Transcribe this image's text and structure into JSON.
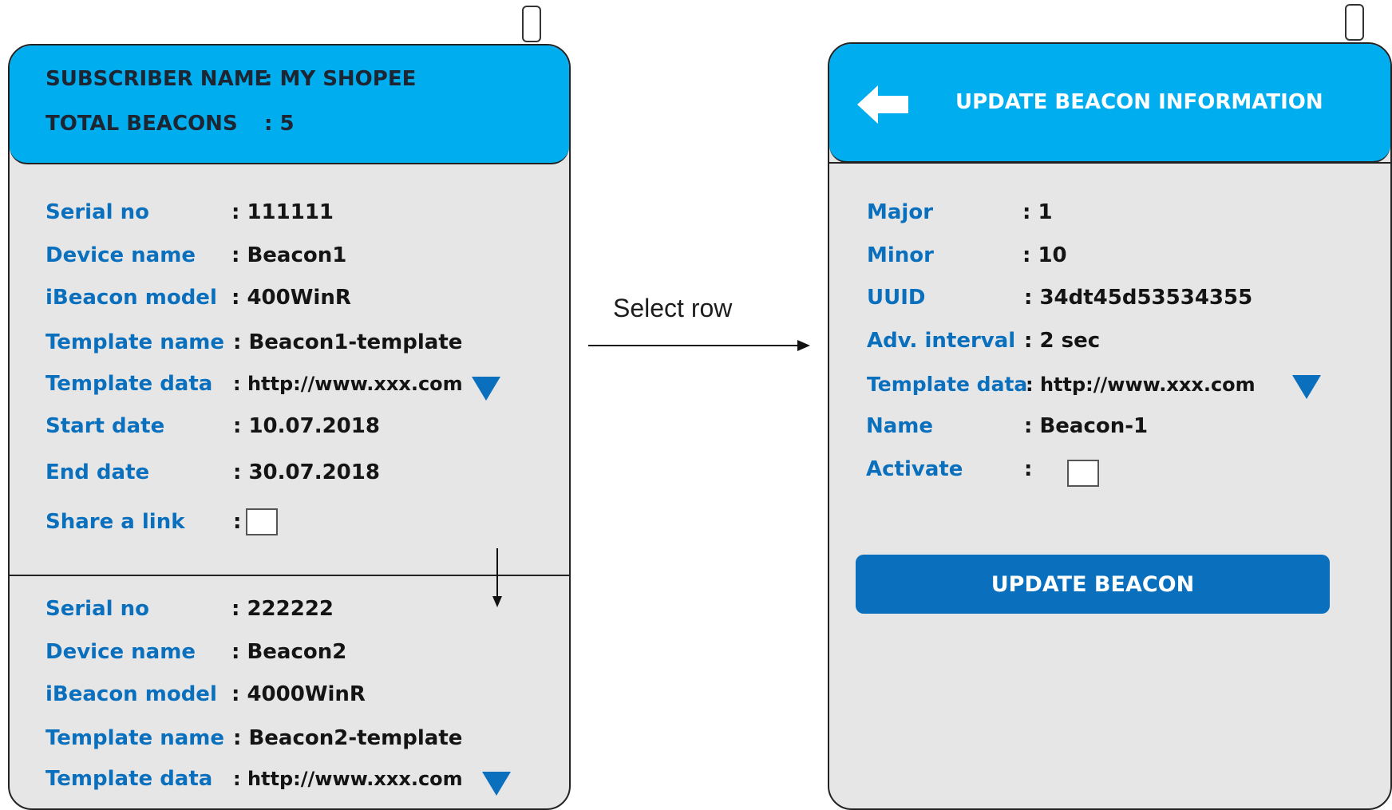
{
  "list_screen": {
    "header": {
      "subscriber_label": "SUBSCRIBER NAME",
      "subscriber_value": ": MY SHOPEE",
      "total_label": "TOTAL BEACONS",
      "total_value": ": 5"
    },
    "records": [
      {
        "serial_label": "Serial no",
        "serial_value": ": 111111",
        "device_label": "Device name",
        "device_value": ": Beacon1",
        "model_label": "iBeacon model",
        "model_value": ": 400WinR",
        "template_name_label": "Template name",
        "template_name_value": ": Beacon1-template",
        "template_data_label": "Template data",
        "template_data_value": ": http://www.xxx.com",
        "start_label": "Start date",
        "start_value": ": 10.07.2018",
        "end_label": "End date",
        "end_value": ": 30.07.2018",
        "share_label": "Share a link",
        "share_colon": ":"
      },
      {
        "serial_label": "Serial no",
        "serial_value": ": 222222",
        "device_label": "Device name",
        "device_value": ": Beacon2",
        "model_label": "iBeacon model",
        "model_value": ": 4000WinR",
        "template_name_label": "Template name",
        "template_name_value": ": Beacon2-template",
        "template_data_label": "Template data",
        "template_data_value": ": http://www.xxx.com"
      }
    ]
  },
  "transition": {
    "label": "Select row"
  },
  "detail_screen": {
    "title": "UPDATE BEACON INFORMATION",
    "fields": {
      "major_label": "Major",
      "major_value": ": 1",
      "minor_label": "Minor",
      "minor_value": ": 10",
      "uuid_label": "UUID",
      "uuid_value": ": 34dt45d53534355",
      "adv_label": "Adv. interval",
      "adv_value": ": 2 sec",
      "template_label": "Template data",
      "template_value": ": http://www.xxx.com",
      "name_label": "Name",
      "name_value": ": Beacon-1",
      "activate_label": "Activate",
      "activate_colon": ":"
    },
    "update_button": "UPDATE BEACON"
  },
  "colors": {
    "header": "#00adef",
    "label": "#0a6fbd",
    "button": "#0a6fbd",
    "screen_bg": "#e6e6e6"
  }
}
